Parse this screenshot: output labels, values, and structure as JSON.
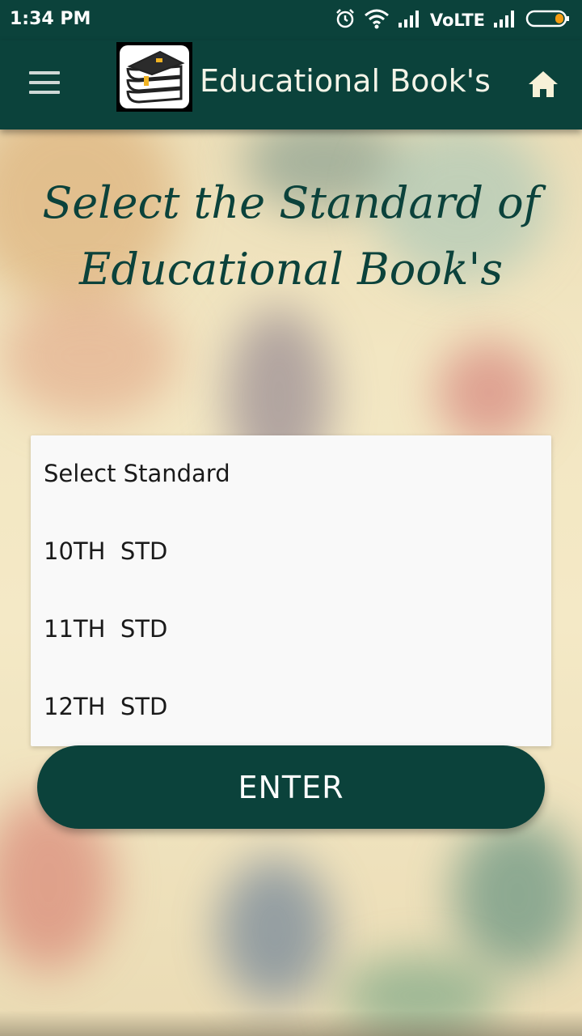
{
  "status_bar": {
    "time": "1:34 PM",
    "network_label": "VoLTE",
    "icons": [
      "alarm-icon",
      "wifi-icon",
      "signal-icon",
      "signal-icon",
      "battery-icon"
    ],
    "battery_color": "#f39c12"
  },
  "app_bar": {
    "title": "Educational Book's",
    "menu_icon": "hamburger-menu-icon",
    "logo_icon": "books-stack-icon",
    "home_icon": "home-icon",
    "color": "#0b423b"
  },
  "headline": {
    "line1": "Select the Standard  of",
    "line2": "Educational Book's"
  },
  "dropdown": {
    "items": [
      {
        "label": "Select Standard"
      },
      {
        "label": "10TH  STD"
      },
      {
        "label": "11TH  STD"
      },
      {
        "label": "12TH  STD"
      }
    ]
  },
  "enter_button": {
    "label": "ENTER"
  }
}
